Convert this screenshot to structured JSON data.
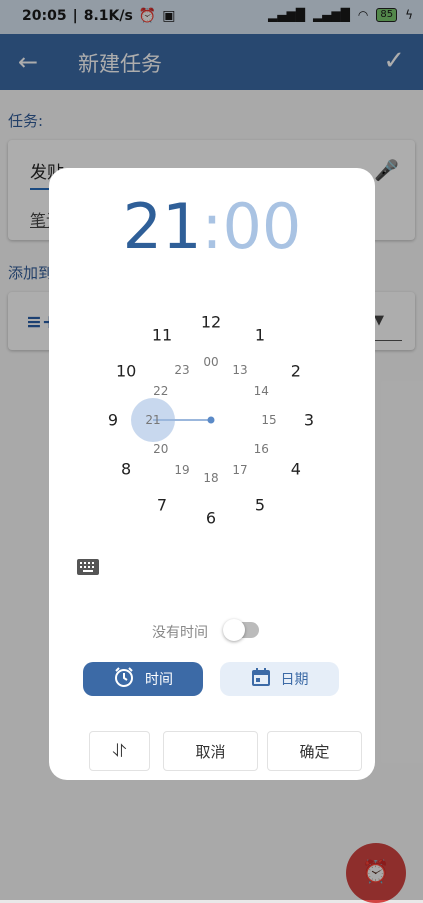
{
  "status_bar": {
    "time": "20:05",
    "speed": "8.1K/s",
    "battery": "85"
  },
  "toolbar": {
    "title": "新建任务"
  },
  "form": {
    "task_label": "任务:",
    "task_value": "发贴",
    "note_value": "笔记",
    "add_to_label": "添加到"
  },
  "dialog": {
    "hour": "21",
    "colon": ":",
    "minute": "00",
    "outer_hours": [
      "12",
      "1",
      "2",
      "3",
      "4",
      "5",
      "6",
      "7",
      "8",
      "9",
      "10",
      "11"
    ],
    "inner_hours": [
      "00",
      "13",
      "14",
      "15",
      "16",
      "17",
      "18",
      "19",
      "20",
      "21",
      "22",
      "23"
    ],
    "selected_hour": "21",
    "no_time_label": "没有时间",
    "no_time_enabled": false,
    "tab_time": "时间",
    "tab_date": "日期",
    "cancel_label": "取消",
    "ok_label": "确定"
  },
  "colors": {
    "primary": "#3c6aa6",
    "accent_light": "#a9c3e3",
    "fab": "#d24442"
  },
  "icons": [
    "back-arrow-icon",
    "check-icon",
    "mic-icon",
    "list-add-icon",
    "keyboard-icon",
    "alarm-clock-icon",
    "calendar-icon",
    "compress-icon",
    "add-alarm-icon"
  ]
}
